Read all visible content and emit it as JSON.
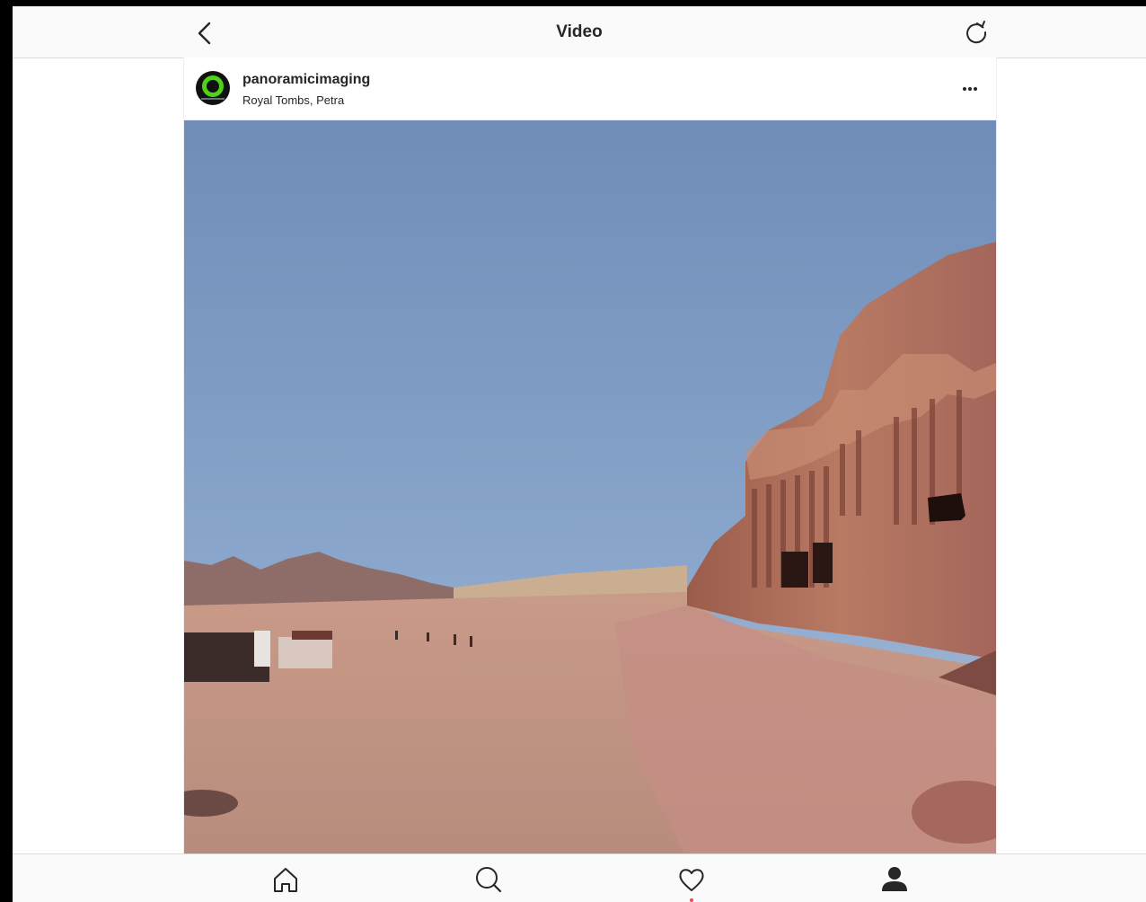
{
  "header": {
    "title": "Video",
    "back_icon": "chevron-left-icon",
    "refresh_icon": "refresh-icon"
  },
  "post": {
    "username": "panoramicimaging",
    "location": "Royal Tombs, Petra",
    "more_icon": "more-horizontal-icon",
    "avatar_accent": "#4ed319"
  },
  "bottom_nav": {
    "items": [
      {
        "icon": "home-icon"
      },
      {
        "icon": "search-icon"
      },
      {
        "icon": "heart-icon",
        "active": true
      },
      {
        "icon": "profile-icon"
      }
    ],
    "active_color": "#ed4956"
  }
}
